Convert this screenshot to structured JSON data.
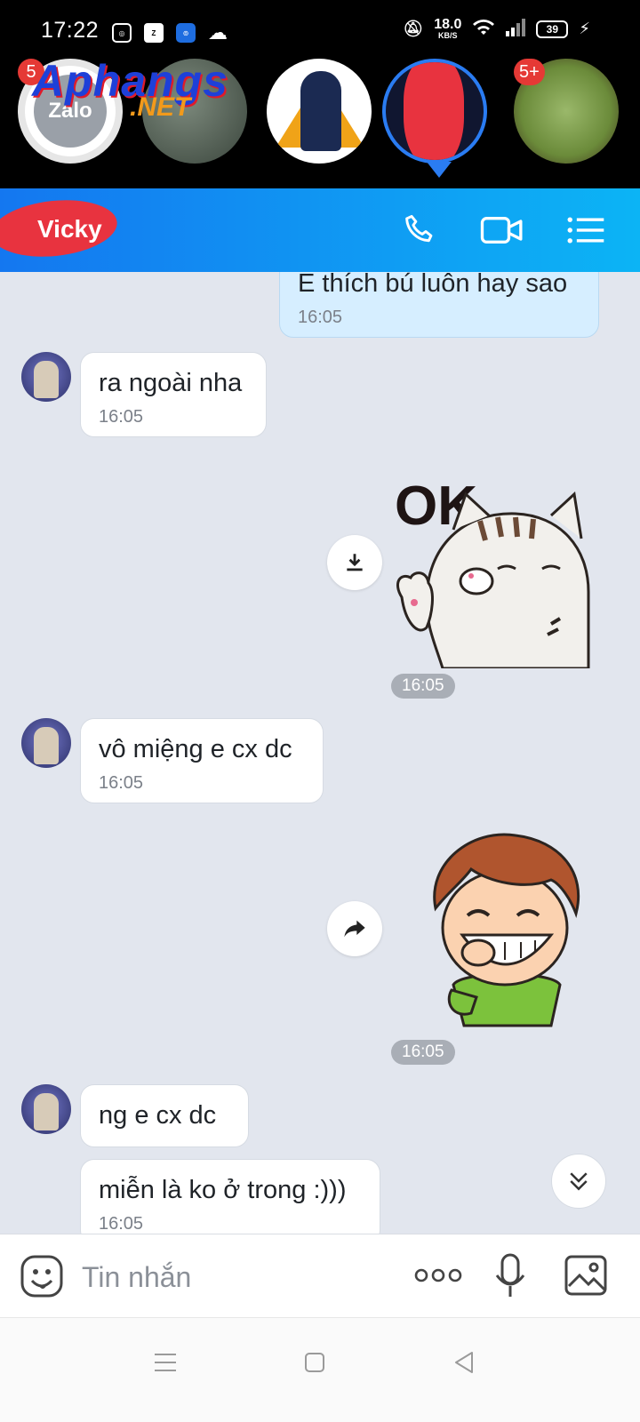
{
  "status_bar": {
    "time": "17:22",
    "net_speed_value": "18.0",
    "net_speed_unit": "KB/S",
    "battery": "39"
  },
  "floating_bubbles": {
    "zalo_label": "Zalo",
    "badge_left": "5",
    "badge_right": "5+"
  },
  "watermark": {
    "brand": "Aphangs",
    "suffix": ".NET"
  },
  "header": {
    "contact_name": "Vicky"
  },
  "messages": [
    {
      "text": "E thích bú luôn hay sao",
      "time": "16:05"
    },
    {
      "text": "ra ngoài nha",
      "time": "16:05"
    },
    {
      "text": "vô miệng e cx dc",
      "time": "16:05"
    },
    {
      "text": "ng  e cx dc",
      "time": ""
    },
    {
      "text": "miễn là ko ở trong :)))",
      "time": "16:05"
    }
  ],
  "sticker_times": [
    "16:05",
    "16:05"
  ],
  "sticker_text": "OK",
  "input": {
    "placeholder": "Tin nhắn"
  },
  "colors": {
    "header_start": "#1477f0",
    "header_end": "#0cb4f5",
    "outgoing_bubble": "#d6eeff",
    "chat_background": "#e2e6ee"
  }
}
